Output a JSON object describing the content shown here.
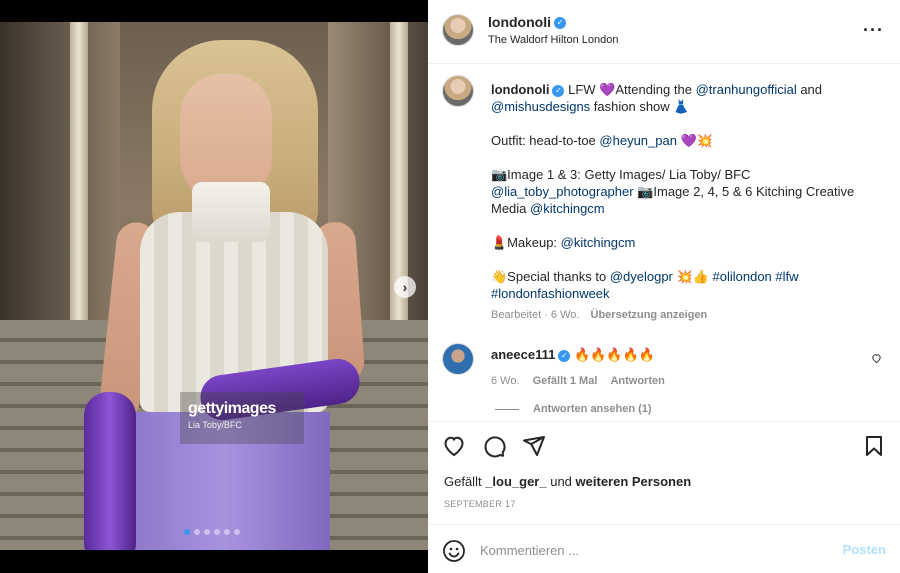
{
  "post": {
    "username": "londonoli",
    "location": "The Waldorf Hilton London",
    "more_icon": "more-horizontal-icon"
  },
  "media": {
    "watermark_main": "gettyimages",
    "watermark_sub": "Lia Toby/BFC",
    "next_icon": "chevron-right-icon",
    "slide_count": 6,
    "active_slide": 1
  },
  "caption": {
    "username": "londonoli",
    "line1_pre": " LFW 💜Attending the ",
    "mention1": "@tranhungofficial",
    "line1_mid": " and ",
    "mention2": "@mishusdesigns",
    "line1_post": " fashion show 👗",
    "outfit_pre": "Outfit: head-to-toe ",
    "outfit_mention": "@heyun_pan",
    "outfit_post": " 💜💥",
    "credit1_pre": "📷Image 1 & 3: Getty Images/ Lia Toby/ BFC",
    "credit1_mention": "@lia_toby_photographer",
    "credit2_pre": " 📷Image 2, 4, 5 & 6 Kitching Creative Media ",
    "credit2_mention": "@kitchingcm",
    "makeup_pre": "💄Makeup: ",
    "makeup_mention": "@kitchingcm",
    "thanks_pre": "👋Special thanks to ",
    "thanks_mention": "@dyelogpr",
    "thanks_mid": " 💥👍 ",
    "hashtag1": "#olilondon",
    "hashtag2": "#lfw",
    "hashtag3": "#londonfashionweek",
    "edited": "Bearbeitet · 6 Wo.",
    "translate": "Übersetzung anzeigen"
  },
  "reply": {
    "username": "aneece111",
    "text": " 🔥🔥🔥🔥🔥",
    "age": "6 Wo.",
    "likes": "Gefällt 1 Mal",
    "reply_label": "Antworten",
    "view_replies": "Antworten ansehen (1)"
  },
  "actions": {
    "likes_prefix": "Gefällt ",
    "likes_user": "_lou_ger_",
    "likes_mid": " und ",
    "likes_suffix": "weiteren Personen",
    "date": "SEPTEMBER 17"
  },
  "compose": {
    "placeholder": "Kommentieren ...",
    "post_label": "Posten"
  },
  "colors": {
    "accent": "#3897f0",
    "link": "#00376b",
    "post_disabled": "#b2dffc"
  }
}
